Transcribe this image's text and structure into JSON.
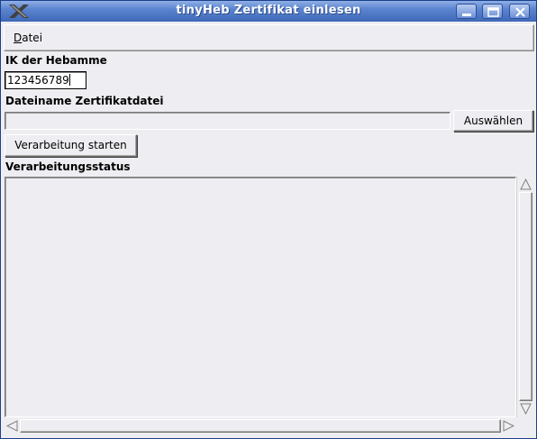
{
  "window": {
    "title": "tinyHeb Zertifikat einlesen",
    "app_icon": "x11-icon",
    "controls": [
      "minimize-icon",
      "maximize-icon",
      "close-icon"
    ]
  },
  "menu": {
    "datei_mnemonic": "D",
    "datei_rest": "atei"
  },
  "form": {
    "ik_label": "IK der Hebamme",
    "ik_value": "123456789",
    "file_label": "Dateiname Zertifikatdatei",
    "file_value": "",
    "choose_button": "Auswählen",
    "start_button": "Verarbeitung starten",
    "status_label": "Verarbeitungsstatus",
    "status_text": ""
  },
  "colors": {
    "titlebar": "#5b84cf",
    "window_bg": "#eeeef2"
  }
}
